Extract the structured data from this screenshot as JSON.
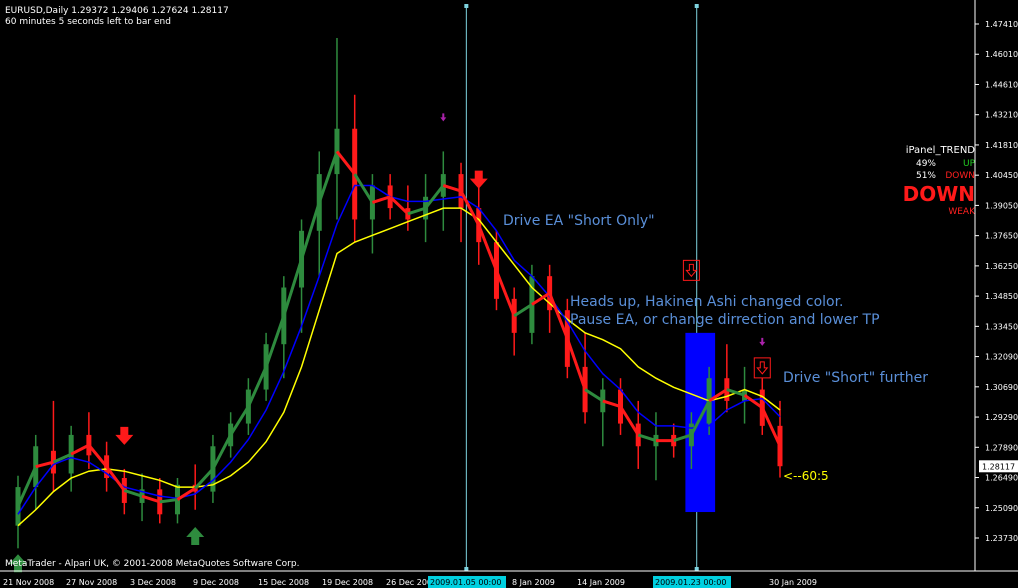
{
  "header": {
    "symbol_line": "EURUSD,Daily  1.29372 1.29406 1.27624 1.28117",
    "timer_line": "60 minutes 5 seconds left to bar end"
  },
  "footer": {
    "copyright": "MetaTrader - Alpari UK, © 2001-2008 MetaQuotes Software Corp."
  },
  "panel": {
    "title": "iPanel_TREND",
    "up_pct": "49%",
    "up_label": "UP",
    "down_pct": "51%",
    "down_label": "DOWN",
    "big_label": "DOWN",
    "strength": "WEAK"
  },
  "annotations": {
    "drive_short_only": "Drive EA \"Short Only\"",
    "heads_up_1": "Heads up, Hakinen Ashi changed color.",
    "heads_up_2": "Pause EA, or change dirrection and lower TP",
    "drive_further": "Drive \"Short\" further",
    "countdown": "<--60:5"
  },
  "colors": {
    "bull": "#2e8b3e",
    "bear": "#ff1a1a",
    "ma_blue": "#0000ff",
    "ma_yellow": "#ffff00",
    "vline": "#7fd4e0",
    "annotation_text": "#5a8fd8",
    "highlight_box": "#0000ff",
    "axis": "#ffffff"
  },
  "chart_data": {
    "type": "candlestick",
    "symbol": "EURUSD",
    "timeframe": "Daily",
    "ylim": [
      1.235,
      1.485
    ],
    "y_ticks": [
      "1.47410",
      "1.46010",
      "1.44610",
      "1.43210",
      "1.41810",
      "1.40450",
      "1.39050",
      "1.37650",
      "1.36250",
      "1.34850",
      "1.33450",
      "1.32090",
      "1.30690",
      "1.29290",
      "1.27890",
      "1.26490",
      "1.25090",
      "1.23730"
    ],
    "current_price": "1.28117",
    "x_labels": [
      "21 Nov 2008",
      "27 Nov 2008",
      "3 Dec 2008",
      "9 Dec 2008",
      "15 Dec 2008",
      "19 Dec 2008",
      "26 Dec 2008",
      "2009.01.05 00:00",
      "8 Jan 2009",
      "14 Jan 2009",
      "2009.01.23 00:00",
      "30 Jan 2009"
    ],
    "highlighted_x_labels": [
      "2009.01.05 00:00",
      "2009.01.23 00:00"
    ],
    "bars": [
      {
        "o": 1.255,
        "h": 1.277,
        "l": 1.245,
        "c": 1.272
      },
      {
        "o": 1.272,
        "h": 1.295,
        "l": 1.262,
        "c": 1.29
      },
      {
        "o": 1.288,
        "h": 1.31,
        "l": 1.27,
        "c": 1.278
      },
      {
        "o": 1.278,
        "h": 1.299,
        "l": 1.27,
        "c": 1.295
      },
      {
        "o": 1.295,
        "h": 1.305,
        "l": 1.28,
        "c": 1.286
      },
      {
        "o": 1.286,
        "h": 1.292,
        "l": 1.27,
        "c": 1.276
      },
      {
        "o": 1.276,
        "h": 1.28,
        "l": 1.26,
        "c": 1.265
      },
      {
        "o": 1.265,
        "h": 1.278,
        "l": 1.257,
        "c": 1.271
      },
      {
        "o": 1.271,
        "h": 1.276,
        "l": 1.256,
        "c": 1.26
      },
      {
        "o": 1.26,
        "h": 1.276,
        "l": 1.256,
        "c": 1.273
      },
      {
        "o": 1.273,
        "h": 1.282,
        "l": 1.262,
        "c": 1.27
      },
      {
        "o": 1.27,
        "h": 1.295,
        "l": 1.265,
        "c": 1.29
      },
      {
        "o": 1.29,
        "h": 1.305,
        "l": 1.285,
        "c": 1.3
      },
      {
        "o": 1.3,
        "h": 1.32,
        "l": 1.295,
        "c": 1.315
      },
      {
        "o": 1.315,
        "h": 1.34,
        "l": 1.31,
        "c": 1.335
      },
      {
        "o": 1.335,
        "h": 1.365,
        "l": 1.32,
        "c": 1.36
      },
      {
        "o": 1.36,
        "h": 1.39,
        "l": 1.34,
        "c": 1.385
      },
      {
        "o": 1.385,
        "h": 1.42,
        "l": 1.365,
        "c": 1.41
      },
      {
        "o": 1.41,
        "h": 1.47,
        "l": 1.39,
        "c": 1.43
      },
      {
        "o": 1.43,
        "h": 1.445,
        "l": 1.38,
        "c": 1.39
      },
      {
        "o": 1.39,
        "h": 1.41,
        "l": 1.375,
        "c": 1.405
      },
      {
        "o": 1.405,
        "h": 1.41,
        "l": 1.39,
        "c": 1.395
      },
      {
        "o": 1.395,
        "h": 1.405,
        "l": 1.385,
        "c": 1.39
      },
      {
        "o": 1.39,
        "h": 1.41,
        "l": 1.38,
        "c": 1.4
      },
      {
        "o": 1.4,
        "h": 1.42,
        "l": 1.385,
        "c": 1.41
      },
      {
        "o": 1.41,
        "h": 1.415,
        "l": 1.38,
        "c": 1.395
      },
      {
        "o": 1.395,
        "h": 1.405,
        "l": 1.37,
        "c": 1.38
      },
      {
        "o": 1.38,
        "h": 1.385,
        "l": 1.35,
        "c": 1.355
      },
      {
        "o": 1.355,
        "h": 1.36,
        "l": 1.33,
        "c": 1.34
      },
      {
        "o": 1.34,
        "h": 1.37,
        "l": 1.335,
        "c": 1.365
      },
      {
        "o": 1.365,
        "h": 1.37,
        "l": 1.34,
        "c": 1.35
      },
      {
        "o": 1.35,
        "h": 1.355,
        "l": 1.32,
        "c": 1.325
      },
      {
        "o": 1.325,
        "h": 1.34,
        "l": 1.3,
        "c": 1.305
      },
      {
        "o": 1.305,
        "h": 1.32,
        "l": 1.29,
        "c": 1.315
      },
      {
        "o": 1.315,
        "h": 1.32,
        "l": 1.295,
        "c": 1.3
      },
      {
        "o": 1.3,
        "h": 1.31,
        "l": 1.28,
        "c": 1.29
      },
      {
        "o": 1.29,
        "h": 1.305,
        "l": 1.275,
        "c": 1.295
      },
      {
        "o": 1.295,
        "h": 1.3,
        "l": 1.285,
        "c": 1.29
      },
      {
        "o": 1.29,
        "h": 1.305,
        "l": 1.28,
        "c": 1.3
      },
      {
        "o": 1.3,
        "h": 1.325,
        "l": 1.295,
        "c": 1.32
      },
      {
        "o": 1.32,
        "h": 1.335,
        "l": 1.305,
        "c": 1.31
      },
      {
        "o": 1.31,
        "h": 1.325,
        "l": 1.3,
        "c": 1.315
      },
      {
        "o": 1.315,
        "h": 1.32,
        "l": 1.295,
        "c": 1.299
      },
      {
        "o": 1.299,
        "h": 1.31,
        "l": 1.2762,
        "c": 1.2812
      }
    ],
    "ma_blue": [
      1.26,
      1.272,
      1.282,
      1.285,
      1.283,
      1.278,
      1.272,
      1.27,
      1.268,
      1.267,
      1.269,
      1.275,
      1.283,
      1.293,
      1.306,
      1.323,
      1.343,
      1.365,
      1.388,
      1.405,
      1.405,
      1.4,
      1.398,
      1.398,
      1.399,
      1.4,
      1.395,
      1.385,
      1.372,
      1.365,
      1.356,
      1.345,
      1.332,
      1.322,
      1.315,
      1.305,
      1.299,
      1.299,
      1.298,
      1.299,
      1.306,
      1.31,
      1.311,
      1.303
    ],
    "ma_yellow": [
      1.255,
      1.262,
      1.27,
      1.276,
      1.279,
      1.28,
      1.279,
      1.277,
      1.275,
      1.272,
      1.272,
      1.273,
      1.277,
      1.283,
      1.292,
      1.305,
      1.325,
      1.35,
      1.375,
      1.38,
      1.383,
      1.386,
      1.389,
      1.392,
      1.395,
      1.395,
      1.39,
      1.38,
      1.37,
      1.36,
      1.353,
      1.346,
      1.34,
      1.337,
      1.333,
      1.325,
      1.32,
      1.316,
      1.313,
      1.31,
      1.312,
      1.315,
      1.312,
      1.306
    ],
    "signals": [
      {
        "type": "buy_arrow",
        "bar": 0,
        "price": 1.238
      },
      {
        "type": "buy_arrow",
        "bar": 10,
        "price": 1.25
      },
      {
        "type": "sell_arrow",
        "bar": 6,
        "price": 1.295
      },
      {
        "type": "sell_arrow",
        "bar": 26,
        "price": 1.408
      },
      {
        "type": "small_sell_arrow",
        "bar": 24,
        "price": 1.435
      },
      {
        "type": "small_sell_arrow",
        "bar": 42,
        "price": 1.336
      },
      {
        "type": "boxed_sell_arrow",
        "bar": 38,
        "price": 1.368
      },
      {
        "type": "boxed_sell_arrow",
        "bar": 42,
        "price": 1.325
      }
    ],
    "highlight_box": {
      "bar_from": 38,
      "bar_to": 39,
      "price_from": 1.261,
      "price_to": 1.34
    },
    "vertical_lines_at_bars": [
      25,
      38
    ]
  }
}
